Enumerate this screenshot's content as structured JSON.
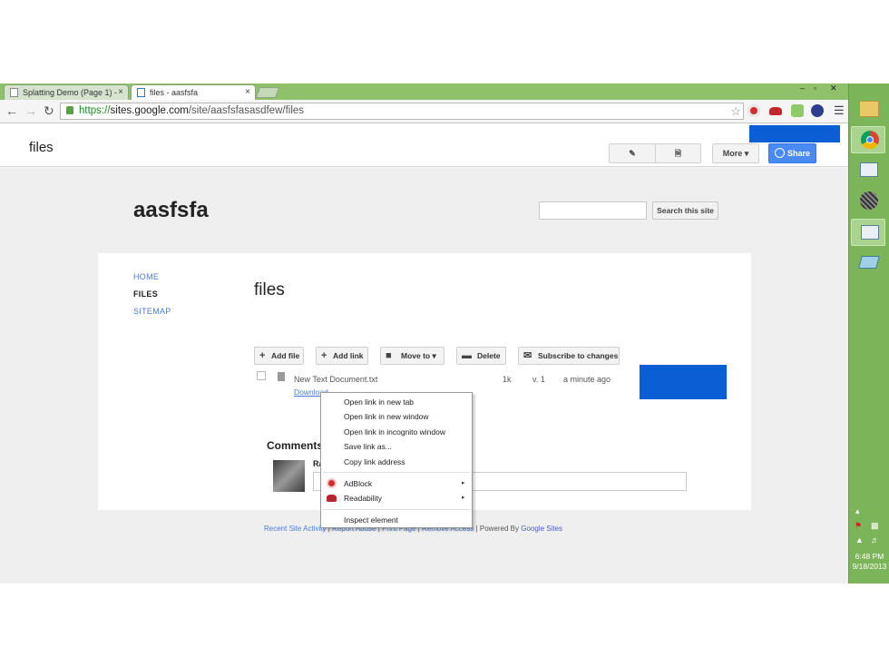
{
  "browser": {
    "tabs": [
      {
        "label": "Splatting Demo (Page 1) -",
        "active": false
      },
      {
        "label": "files - aasfsfa",
        "active": true
      }
    ],
    "url_scheme": "https://",
    "url_host": "sites.google.com",
    "url_path": "/site/aasfsfasasdfew/files",
    "close_glyph": "×",
    "window_controls": [
      "‒",
      "▫",
      "✕"
    ]
  },
  "sites_header": {
    "title": "files",
    "more_label": "More ▾",
    "share_label": "Share"
  },
  "site": {
    "name": "aasfsfa",
    "search_button": "Search this site",
    "search_placeholder": ""
  },
  "nav": {
    "items": [
      {
        "label": "HOME",
        "active": false
      },
      {
        "label": "FILES",
        "active": true
      },
      {
        "label": "SITEMAP",
        "active": false
      }
    ]
  },
  "page": {
    "title": "files",
    "actions": {
      "add_file": "Add file",
      "add_link": "Add link",
      "move_to": "Move to ▾",
      "delete": "Delete",
      "subscribe": "Subscribe to changes"
    },
    "file": {
      "name": "New Text Document.txt",
      "download": "Download",
      "size": "1k",
      "version": "v. 1",
      "time": "a minute ago"
    },
    "comments": {
      "heading": "Comments",
      "author_initial": "Ra"
    }
  },
  "footer": {
    "recent_activity": "Recent Site Activity",
    "report_abuse": "Report Abuse",
    "print_page": "Print Page",
    "remove_access": "Remove Access",
    "powered_by": "Powered By",
    "google_sites": "Google Sites",
    "separator": "|"
  },
  "context_menu": {
    "items": [
      "Open link in new tab",
      "Open link in new window",
      "Open link in incognito window",
      "Save link as...",
      "Copy link address"
    ],
    "extensions": [
      "AdBlock",
      "Readability"
    ],
    "inspect": "Inspect element",
    "submenu_arrow": "▸"
  },
  "taskbar": {
    "time": "6:48 PM",
    "date": "9/18/2013"
  },
  "colors": {
    "tabstrip": "#8fc06a",
    "taskbar": "#7cb559",
    "link": "#4a7dd1",
    "share": "#4a8af4",
    "redaction_blue": "#0b5ed4"
  },
  "icons": [
    "pencil-icon",
    "new-page-icon",
    "globe-icon",
    "file-icon",
    "folder-icon",
    "trash-icon",
    "mail-icon",
    "star-icon",
    "lock-icon",
    "adblock-icon",
    "readability-icon",
    "chrome-icon"
  ]
}
